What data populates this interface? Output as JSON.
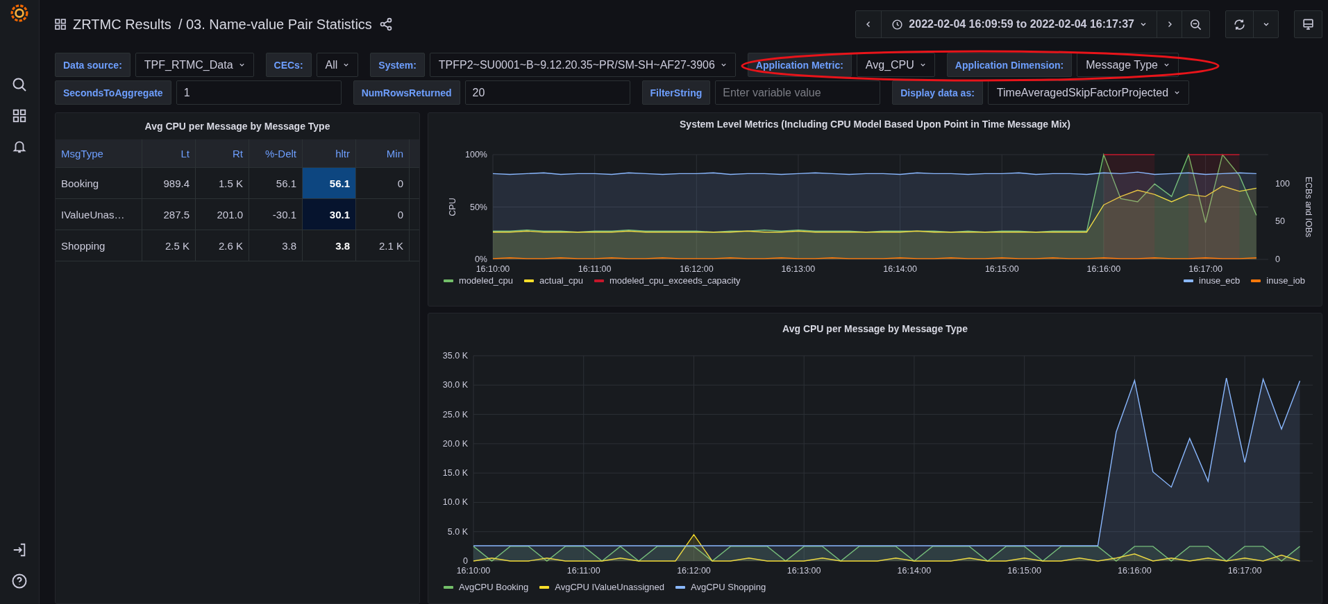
{
  "breadcrumb": {
    "folder": "ZRTMC Results",
    "dashboard": "/ 03. Name-value Pair Statistics"
  },
  "time_range": "2022-02-04 16:09:59 to 2022-02-04 16:17:37",
  "variables": [
    [
      {
        "label": "Data source:",
        "kind": "select",
        "value": "TPF_RTMC_Data"
      },
      {
        "label": "CECs:",
        "kind": "select",
        "value": "All"
      },
      {
        "label": "System:",
        "kind": "select",
        "value": "TPFP2~SU0001~B~9.12.20.35~PR/SM-SH~AF27-3906"
      },
      {
        "label": "Application Metric:",
        "kind": "select",
        "value": "Avg_CPU"
      },
      {
        "label": "Application Dimension:",
        "kind": "select",
        "value": "Message Type"
      }
    ],
    [
      {
        "label": "SecondsToAggregate",
        "kind": "text",
        "value": "1"
      },
      {
        "label": "NumRowsReturned",
        "kind": "text",
        "value": "20"
      },
      {
        "label": "FilterString",
        "kind": "text",
        "placeholder": "Enter variable value"
      },
      {
        "label": "Display data as:",
        "kind": "select",
        "value": "TimeAveragedSkipFactorProjected"
      }
    ]
  ],
  "table": {
    "title": "Avg CPU per Message by Message Type",
    "columns": [
      "MsgType",
      "Lt",
      "Rt",
      "%-Delt",
      "hltr",
      "Min"
    ],
    "rows": [
      {
        "cells": [
          "Booking",
          "989.4",
          "1.5 K",
          "56.1",
          "56.1",
          "0"
        ],
        "color": "#0d4680"
      },
      {
        "cells": [
          "IValueUnas…",
          "287.5",
          "201.0",
          "-30.1",
          "30.1",
          "0"
        ],
        "color": "#06142e"
      },
      {
        "cells": [
          "Shopping",
          "2.5 K",
          "2.6 K",
          "3.8",
          "3.8",
          "2.1 K"
        ]
      }
    ]
  },
  "charts": [
    {
      "title": "System Level Metrics (Including CPU Model Based Upon Point in Time Message Mix)",
      "chart_data": {
        "type": "area",
        "grid": true,
        "ylabel": "CPU",
        "y2label": "ECBs and IOBs",
        "categories": [
          "16:10:00",
          null,
          null,
          null,
          null,
          null,
          "16:11:00",
          null,
          null,
          null,
          null,
          null,
          "16:12:00",
          null,
          null,
          null,
          null,
          null,
          "16:13:00",
          null,
          null,
          null,
          null,
          null,
          "16:14:00",
          null,
          null,
          null,
          null,
          null,
          "16:15:00",
          null,
          null,
          null,
          null,
          null,
          "16:16:00",
          null,
          null,
          null,
          null,
          null,
          "16:17:00",
          null,
          null,
          null
        ],
        "ylim": [
          0,
          100
        ],
        "yticks": [
          {
            "value": 0,
            "label": "0%"
          },
          {
            "value": 50,
            "label": "50%"
          },
          {
            "value": 100,
            "label": "100%"
          }
        ],
        "y2lim": [
          0,
          138
        ],
        "y2ticks": [
          0,
          50,
          100
        ],
        "series": [
          {
            "name": "modeled_cpu",
            "color": "#73bf69",
            "values": [
              27,
              27,
              28,
              27,
              27,
              26,
              27,
              27,
              28,
              27,
              27,
              27,
              27,
              26,
              27,
              27,
              28,
              27,
              28,
              27,
              27,
              27,
              26,
              27,
              27,
              27,
              27,
              26,
              27,
              26,
              27,
              27,
              26,
              27,
              27,
              27,
              100,
              58,
              55,
              72,
              60,
              100,
              35,
              100,
              80,
              42
            ]
          },
          {
            "name": "actual_cpu",
            "color": "#fade2a",
            "values": [
              26,
              26,
              27,
              26,
              26,
              26,
              26,
              26,
              27,
              26,
              26,
              26,
              26,
              26,
              26,
              27,
              26,
              26,
              27,
              26,
              26,
              26,
              26,
              26,
              26,
              27,
              26,
              26,
              26,
              26,
              26,
              26,
              26,
              26,
              26,
              26,
              52,
              60,
              66,
              62,
              55,
              62,
              60,
              70,
              65,
              68
            ]
          },
          {
            "name": "modeled_cpu_exceeds_capacity",
            "color": "#c4162a",
            "values": [
              null,
              null,
              null,
              null,
              null,
              null,
              null,
              null,
              null,
              null,
              null,
              null,
              null,
              null,
              null,
              null,
              null,
              null,
              null,
              null,
              null,
              null,
              null,
              null,
              null,
              null,
              null,
              null,
              null,
              null,
              null,
              null,
              null,
              null,
              null,
              null,
              100,
              100,
              100,
              100,
              null,
              100,
              100,
              100,
              100,
              null
            ]
          },
          {
            "name": "inuse_ecb",
            "color": "#8ab8ff",
            "axis": "y2",
            "values": [
              113,
              112,
              113,
              114,
              112,
              113,
              113,
              112,
              114,
              113,
              112,
              113,
              113,
              114,
              112,
              113,
              113,
              112,
              113,
              114,
              113,
              112,
              113,
              113,
              112,
              114,
              113,
              113,
              112,
              113,
              113,
              114,
              112,
              113,
              113,
              112,
              114,
              113,
              115,
              112,
              113,
              114,
              112,
              113,
              114,
              113
            ]
          },
          {
            "name": "inuse_iob",
            "color": "#ff780a",
            "axis": "y2",
            "values": [
              1,
              2,
              1,
              1,
              2,
              1,
              1,
              2,
              1,
              1,
              2,
              1,
              1,
              1,
              2,
              1,
              1,
              2,
              1,
              1,
              2,
              1,
              1,
              1,
              2,
              1,
              1,
              2,
              1,
              1,
              2,
              1,
              1,
              2,
              1,
              1,
              2,
              1,
              1,
              2,
              1,
              1,
              2,
              1,
              1,
              2
            ]
          }
        ]
      }
    },
    {
      "title": "Avg CPU per Message by Message Type",
      "chart_data": {
        "type": "area",
        "grid": true,
        "categories": [
          "16:10:00",
          null,
          null,
          null,
          null,
          null,
          "16:11:00",
          null,
          null,
          null,
          null,
          null,
          "16:12:00",
          null,
          null,
          null,
          null,
          null,
          "16:13:00",
          null,
          null,
          null,
          null,
          null,
          "16:14:00",
          null,
          null,
          null,
          null,
          null,
          "16:15:00",
          null,
          null,
          null,
          null,
          null,
          "16:16:00",
          null,
          null,
          null,
          null,
          null,
          "16:17:00",
          null,
          null,
          null
        ],
        "ylim": [
          0,
          35000
        ],
        "yticks": [
          {
            "value": 0,
            "label": "0"
          },
          {
            "value": 5000,
            "label": "5.0 K"
          },
          {
            "value": 10000,
            "label": "10.0 K"
          },
          {
            "value": 15000,
            "label": "15.0 K"
          },
          {
            "value": 20000,
            "label": "20.0 K"
          },
          {
            "value": 25000,
            "label": "25.0 K"
          },
          {
            "value": 30000,
            "label": "30.0 K"
          },
          {
            "value": 35000,
            "label": "35.0 K"
          }
        ],
        "series": [
          {
            "name": "AvgCPU Booking",
            "color": "#73bf69",
            "values": [
              2500,
              0,
              2500,
              2500,
              0,
              2500,
              2500,
              0,
              2500,
              0,
              2500,
              2500,
              2500,
              0,
              2500,
              2500,
              2500,
              0,
              2500,
              2500,
              0,
              2500,
              2500,
              2500,
              0,
              2500,
              2500,
              2500,
              0,
              2500,
              2500,
              0,
              2500,
              2500,
              2500,
              0,
              2500,
              2500,
              0,
              2500,
              2500,
              0,
              2500,
              2500,
              0,
              2500
            ]
          },
          {
            "name": "AvgCPU IValueUnassigned",
            "color": "#fade2a",
            "values": [
              0,
              500,
              0,
              0,
              500,
              0,
              0,
              0,
              500,
              0,
              0,
              0,
              4500,
              0,
              0,
              500,
              0,
              0,
              0,
              500,
              0,
              0,
              0,
              500,
              0,
              0,
              0,
              500,
              0,
              0,
              500,
              0,
              0,
              500,
              0,
              500,
              1200,
              0,
              500,
              0,
              500,
              0,
              500,
              0,
              1000,
              0
            ]
          },
          {
            "name": "AvgCPU Shopping",
            "color": "#8ab8ff",
            "values": [
              2600,
              2600,
              2600,
              2600,
              2600,
              2600,
              2600,
              2600,
              2600,
              2600,
              2600,
              2600,
              2600,
              2600,
              2600,
              2600,
              2600,
              2600,
              2600,
              2600,
              2600,
              2600,
              2600,
              2600,
              2600,
              2600,
              2600,
              2600,
              2600,
              2600,
              2600,
              2600,
              2600,
              2600,
              2600,
              22000,
              30800,
              15200,
              12600,
              20900,
              13600,
              31200,
              16800,
              31000,
              22500,
              30700
            ]
          }
        ]
      }
    }
  ]
}
